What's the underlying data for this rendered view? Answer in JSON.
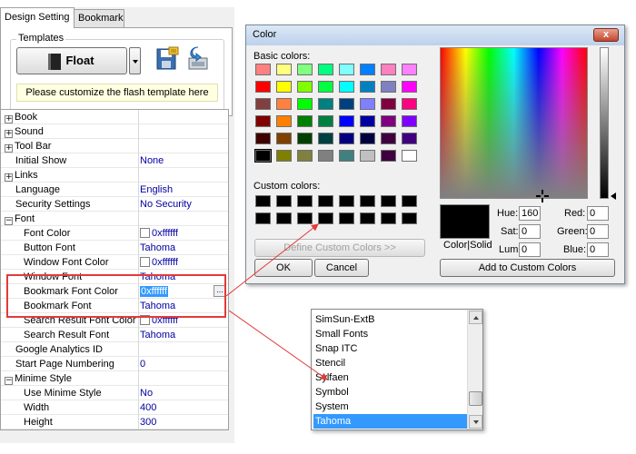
{
  "tabs": {
    "design": "Design Setting",
    "bookmark": "Bookmark"
  },
  "templates": {
    "legend": "Templates",
    "template_button": "Float",
    "note": "Please customize the flash template here"
  },
  "properties": {
    "book": "Book",
    "sound": "Sound",
    "toolbar": "Tool Bar",
    "initial_show": {
      "name": "Initial Show",
      "value": "None"
    },
    "links": "Links",
    "language": {
      "name": "Language",
      "value": "English"
    },
    "security": {
      "name": "Security Settings",
      "value": "No Security"
    },
    "font": "Font",
    "font_color": {
      "name": "Font Color",
      "value": "0xffffff"
    },
    "button_font": {
      "name": "Button Font",
      "value": "Tahoma"
    },
    "window_font_color": {
      "name": "Window Font Color",
      "value": "0xffffff"
    },
    "window_font": {
      "name": "Window Font",
      "value": "Tahoma"
    },
    "bookmark_font_color": {
      "name": "Bookmark Font Color",
      "value": "0xffffff",
      "button": "..."
    },
    "bookmark_font": {
      "name": "Bookmark Font",
      "value": "Tahoma"
    },
    "search_result_font_color": {
      "name": "Search Result Font Color",
      "value": "0xffffff"
    },
    "search_result_font": {
      "name": "Search Result Font",
      "value": "Tahoma"
    },
    "analytics": {
      "name": "Google Analytics ID",
      "value": ""
    },
    "start_page": {
      "name": "Start Page Numbering",
      "value": "0"
    },
    "minime": "Minime Style",
    "use_minime": {
      "name": "Use Minime Style",
      "value": "No"
    },
    "width": {
      "name": "Width",
      "value": "400"
    },
    "height": {
      "name": "Height",
      "value": "300"
    },
    "expand_symbol": "+",
    "collapse_symbol": "−"
  },
  "color_dialog": {
    "title": "Color",
    "close": "x",
    "basic_label": "Basic colors:",
    "custom_label": "Custom colors:",
    "basic_colors": [
      "#ff8080",
      "#ffff80",
      "#80ff80",
      "#00ff80",
      "#80ffff",
      "#0080ff",
      "#ff80c0",
      "#ff80ff",
      "#ff0000",
      "#ffff00",
      "#80ff00",
      "#00ff40",
      "#00ffff",
      "#0080c0",
      "#8080c0",
      "#ff00ff",
      "#804040",
      "#ff8040",
      "#00ff00",
      "#008080",
      "#004080",
      "#8080ff",
      "#800040",
      "#ff0080",
      "#800000",
      "#ff8000",
      "#008000",
      "#008040",
      "#0000ff",
      "#0000a0",
      "#800080",
      "#8000ff",
      "#400000",
      "#804000",
      "#004000",
      "#004040",
      "#000080",
      "#000040",
      "#400040",
      "#400080",
      "#000000",
      "#808000",
      "#808040",
      "#808080",
      "#408080",
      "#c0c0c0",
      "#400040",
      "#ffffff"
    ],
    "define_custom": "Define Custom Colors >>",
    "ok": "OK",
    "cancel": "Cancel",
    "color_solid": "Color|Solid",
    "hue_label": "Hue:",
    "hue": "160",
    "sat_label": "Sat:",
    "sat": "0",
    "lum_label": "Lum:",
    "lum": "0",
    "red_label": "Red:",
    "red": "0",
    "green_label": "Green:",
    "green": "0",
    "blue_label": "Blue:",
    "blue": "0",
    "add_custom": "Add to Custom Colors"
  },
  "font_list": {
    "items": [
      "SimSun-ExtB",
      "Small Fonts",
      "Snap ITC",
      "Stencil",
      "Sylfaen",
      "Symbol",
      "System",
      "Tahoma"
    ],
    "selected": "Tahoma"
  },
  "colors": {
    "highlight": "#e33a3a",
    "selection": "#3399ff",
    "value_text": "#0000a0"
  }
}
